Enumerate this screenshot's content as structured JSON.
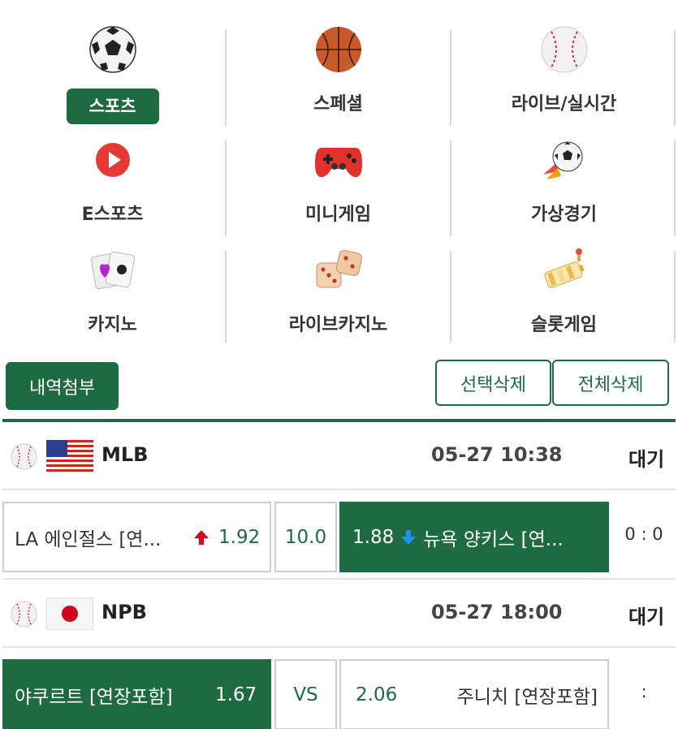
{
  "categories": [
    {
      "label": "스포츠",
      "icon": "soccer-ball-icon",
      "active": true
    },
    {
      "label": "스페셜",
      "icon": "basketball-icon",
      "active": false
    },
    {
      "label": "라이브/실시간",
      "icon": "baseball-icon",
      "active": false
    },
    {
      "label": "E스포츠",
      "icon": "play-button-icon",
      "active": false
    },
    {
      "label": "미니게임",
      "icon": "gamepad-icon",
      "active": false
    },
    {
      "label": "가상경기",
      "icon": "virtual-soccer-icon",
      "active": false
    },
    {
      "label": "카지노",
      "icon": "cards-icon",
      "active": false
    },
    {
      "label": "라이브카지노",
      "icon": "dice-icon",
      "active": false
    },
    {
      "label": "슬롯게임",
      "icon": "slot-reel-icon",
      "active": false
    }
  ],
  "toolbar": {
    "attach_label": "내역첨부",
    "delete_selected_label": "선택삭제",
    "delete_all_label": "전체삭제"
  },
  "matches": [
    {
      "league": "MLB",
      "flag": "us-flag-icon",
      "time": "05-27 10:38",
      "status": "대기",
      "home": "LA 에인절스 [연...",
      "home_odds": "1.92",
      "home_trend": "up",
      "middle": "10.0",
      "away_odds": "1.88",
      "away_trend": "down",
      "away": "뉴욕 양키스 [연...",
      "score": "0 : 0"
    },
    {
      "league": "NPB",
      "flag": "japan-flag-icon",
      "time": "05-27 18:00",
      "status": "대기",
      "home": "야쿠르트 [연장포함]",
      "home_odds": "1.67",
      "middle": "VS",
      "away_odds": "2.06",
      "away": "주니치 [연장포함]",
      "score": ":"
    }
  ],
  "colors": {
    "accent": "#1e6b41",
    "up_arrow": "#d0021b",
    "down_arrow": "#1e90ff"
  }
}
